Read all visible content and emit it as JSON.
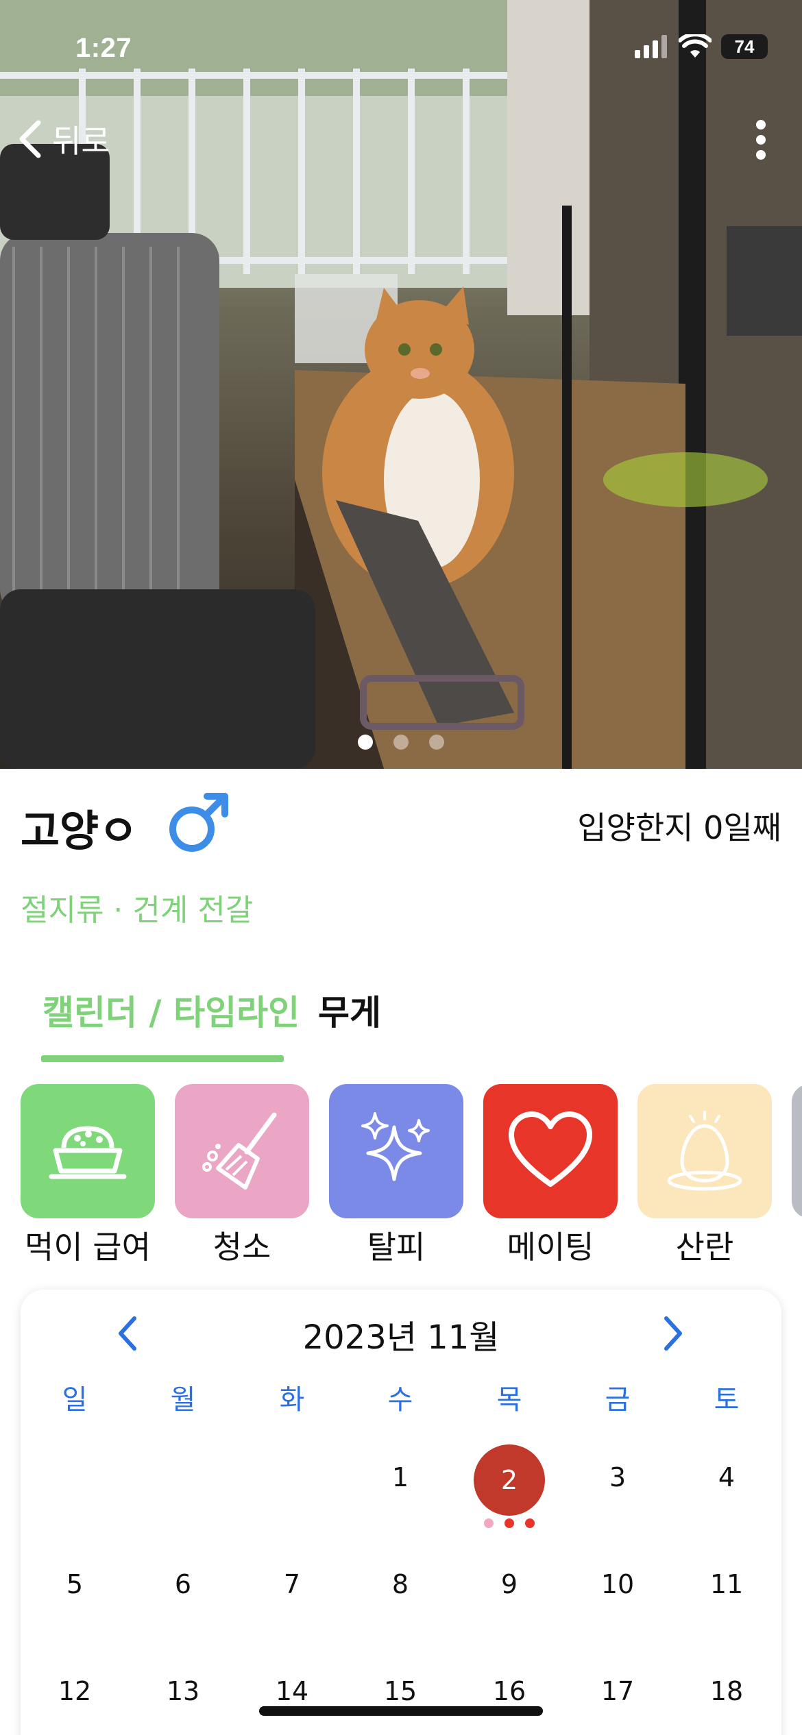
{
  "status_bar": {
    "time": "1:27",
    "battery": "74"
  },
  "nav": {
    "back_label": "뒤로"
  },
  "pet": {
    "name": "고양ㅇ",
    "gender_icon": "male-symbol",
    "adopt_text": "입양한지 0일째",
    "species": "절지류 · 건계 전갈"
  },
  "photos": {
    "count": 3,
    "active_index": 0
  },
  "tabs": [
    {
      "label": "캘린더 / 타임라인",
      "active": true
    },
    {
      "label": "무게",
      "active": false
    }
  ],
  "actions": [
    {
      "label": "먹이 급여",
      "icon": "food-bowl-icon",
      "color": "#7fd97a"
    },
    {
      "label": "청소",
      "icon": "broom-icon",
      "color": "#eaa6c4"
    },
    {
      "label": "탈피",
      "icon": "sparkle-icon",
      "color": "#7b8ae6"
    },
    {
      "label": "메이팅",
      "icon": "heart-icon",
      "color": "#e8352a"
    },
    {
      "label": "산란",
      "icon": "egg-icon",
      "color": "#fbe7bb"
    }
  ],
  "calendar": {
    "title": "2023년 11월",
    "weekdays": [
      "일",
      "월",
      "화",
      "수",
      "목",
      "금",
      "토"
    ],
    "weeks": [
      [
        "",
        "",
        "",
        "1",
        "2",
        "3",
        "4"
      ],
      [
        "5",
        "6",
        "7",
        "8",
        "9",
        "10",
        "11"
      ],
      [
        "12",
        "13",
        "14",
        "15",
        "16",
        "17",
        "18"
      ]
    ],
    "selected_day": "2",
    "event_dot_colors": [
      "#f2a7c3",
      "#e8352a",
      "#e8352a"
    ]
  }
}
